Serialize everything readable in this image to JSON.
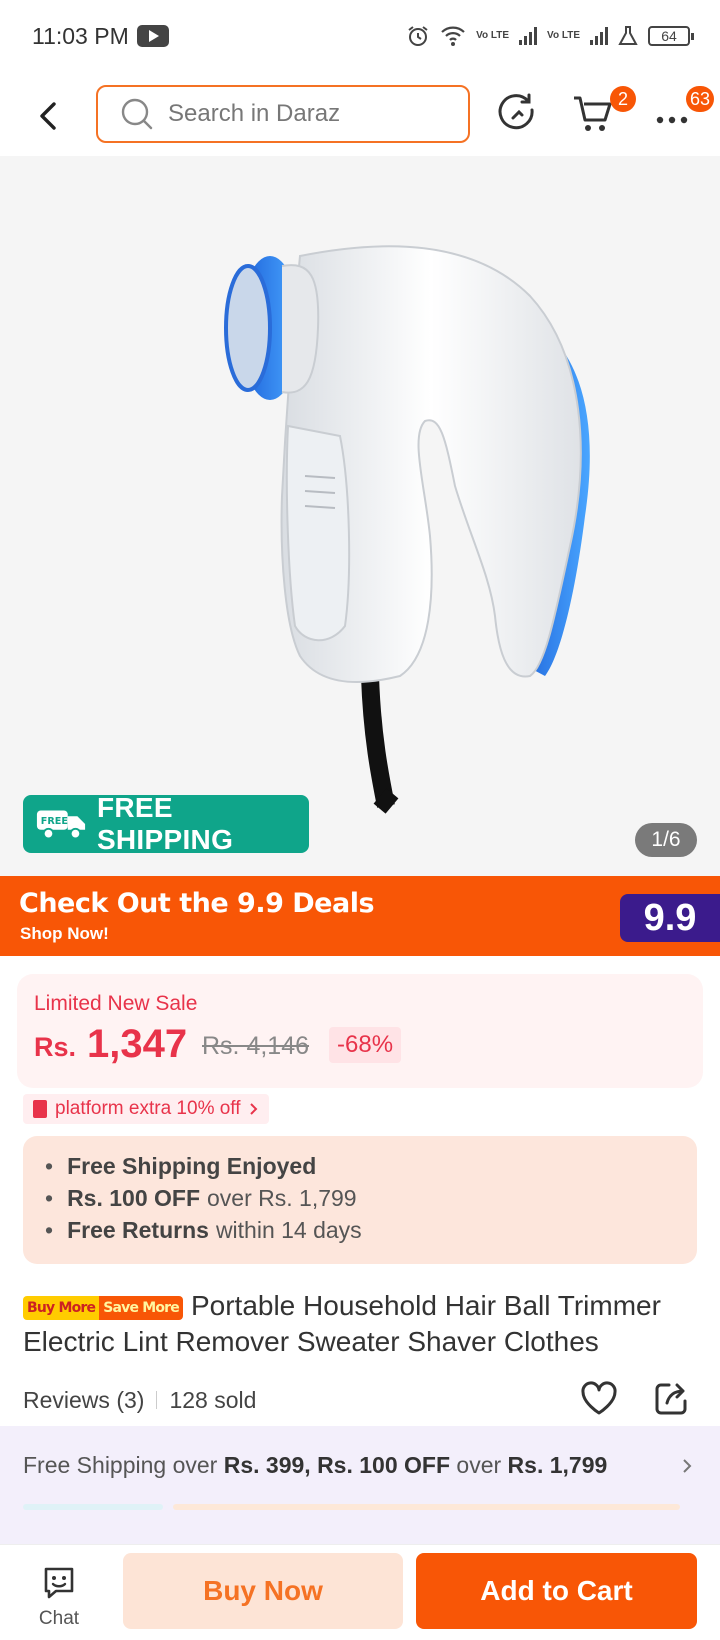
{
  "status_bar": {
    "time": "11:03 PM",
    "battery": "64",
    "volte_label": "Vo LTE"
  },
  "header": {
    "search_placeholder": "Search in Daraz",
    "cart_count": "2",
    "more_count": "63"
  },
  "gallery": {
    "product_image": "lint-remover-product-icon",
    "free_shipping_label": "FREE SHIPPING",
    "free_tag": "FREE",
    "pager": "1/6"
  },
  "deal_banner": {
    "title": "Check Out the 9.9 Deals",
    "subtitle": "Shop Now!",
    "badge": "9.9"
  },
  "price": {
    "label": "Limited New Sale",
    "currency": "Rs.",
    "current": "1,347",
    "original": "Rs. 4,146",
    "discount": "-68%"
  },
  "voucher": {
    "text": "platform extra 10% off"
  },
  "benefits": [
    {
      "bold": "Free Shipping Enjoyed",
      "rest": ""
    },
    {
      "bold": "Rs. 100 OFF",
      "rest": "over Rs. 1,799"
    },
    {
      "bold": "Free Returns",
      "rest": "within 14 days"
    }
  ],
  "product": {
    "tag_a": "Buy More",
    "tag_b": "Save More",
    "title": "Portable Household Hair Ball Trimmer Electric Lint Remover Sweater Shaver Clothes"
  },
  "reviews": {
    "label": "Reviews",
    "count": "(3)",
    "sold": "128 sold"
  },
  "shipping_promo": {
    "prefix": "Free Shipping over ",
    "amount_a": "Rs. 399, Rs. 100 OFF",
    "middle": " over ",
    "amount_b": "Rs. 1,799"
  },
  "bottom_bar": {
    "chat_label": "Chat",
    "buy_now": "Buy Now",
    "add_to_cart": "Add to Cart"
  },
  "colors": {
    "brand_orange": "#f85606",
    "price_red": "#e8334a",
    "free_ship_teal": "#0fa58a",
    "deal_purple": "#3b1b8c"
  }
}
